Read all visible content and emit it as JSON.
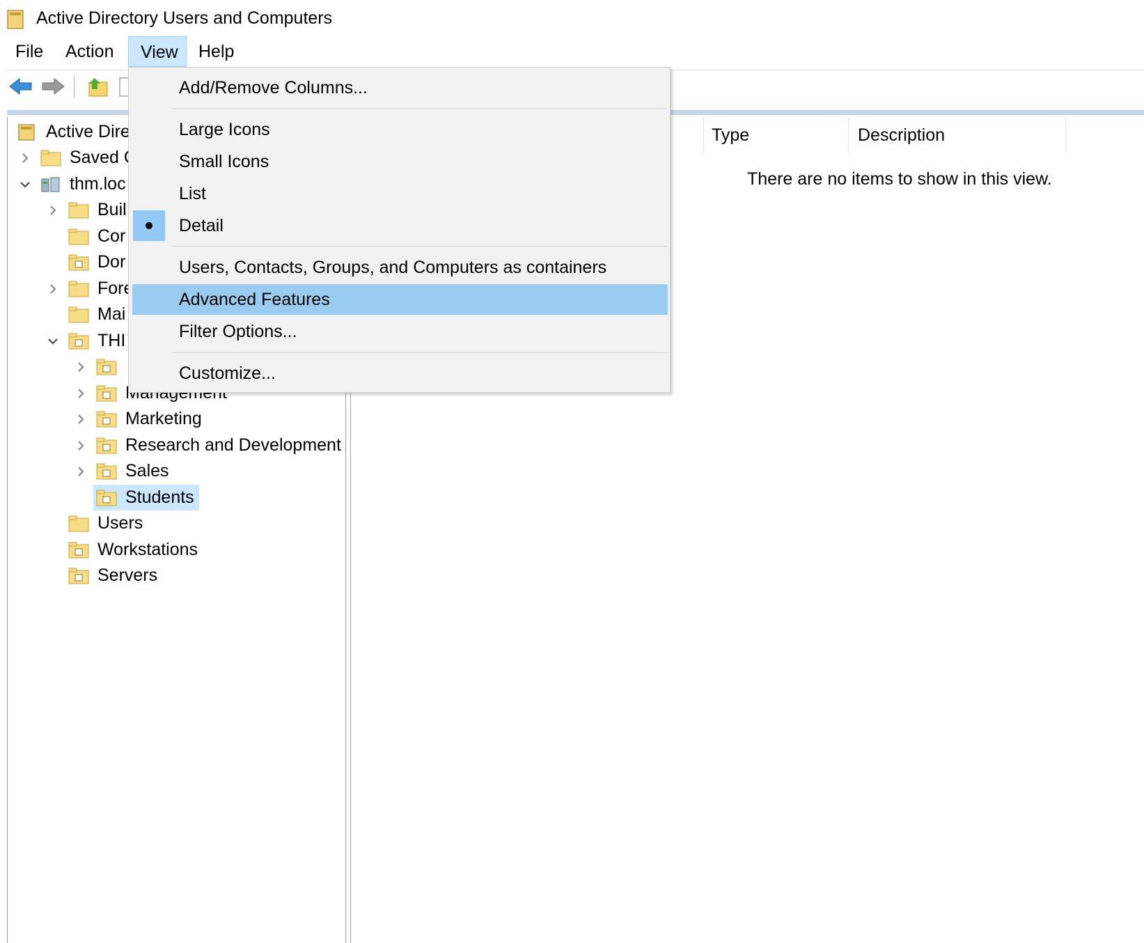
{
  "window": {
    "title": "Active Directory Users and Computers"
  },
  "menubar": {
    "items": [
      "File",
      "Action",
      "View",
      "Help"
    ]
  },
  "tree": {
    "items": [
      {
        "label": "Active Dire"
      },
      {
        "label": "Saved C"
      },
      {
        "label": "thm.loc"
      },
      {
        "label": "Buil"
      },
      {
        "label": "Cor"
      },
      {
        "label": "Dor"
      },
      {
        "label": "Fore"
      },
      {
        "label": "Mai"
      },
      {
        "label": "THI"
      },
      {
        "label": ""
      },
      {
        "label": "Management"
      },
      {
        "label": "Marketing"
      },
      {
        "label": "Research and Development"
      },
      {
        "label": "Sales"
      },
      {
        "label": "Students"
      },
      {
        "label": "Users"
      },
      {
        "label": "Workstations"
      },
      {
        "label": "Servers"
      }
    ]
  },
  "details": {
    "columns": [
      "Type",
      "Description"
    ],
    "empty_message": "There are no items to show in this view."
  },
  "view_menu": {
    "items": [
      {
        "label": "Add/Remove Columns..."
      },
      {
        "label": "Large Icons"
      },
      {
        "label": "Small Icons"
      },
      {
        "label": "List"
      },
      {
        "label": "Detail",
        "selected": true
      },
      {
        "label": "Users, Contacts, Groups, and Computers as containers"
      },
      {
        "label": "Advanced Features",
        "highlighted": true
      },
      {
        "label": "Filter Options..."
      },
      {
        "label": "Customize..."
      }
    ]
  },
  "colors": {
    "selection": "#cce8ff",
    "menu_highlight": "#99ccf0",
    "folder": "#f5d76e"
  }
}
